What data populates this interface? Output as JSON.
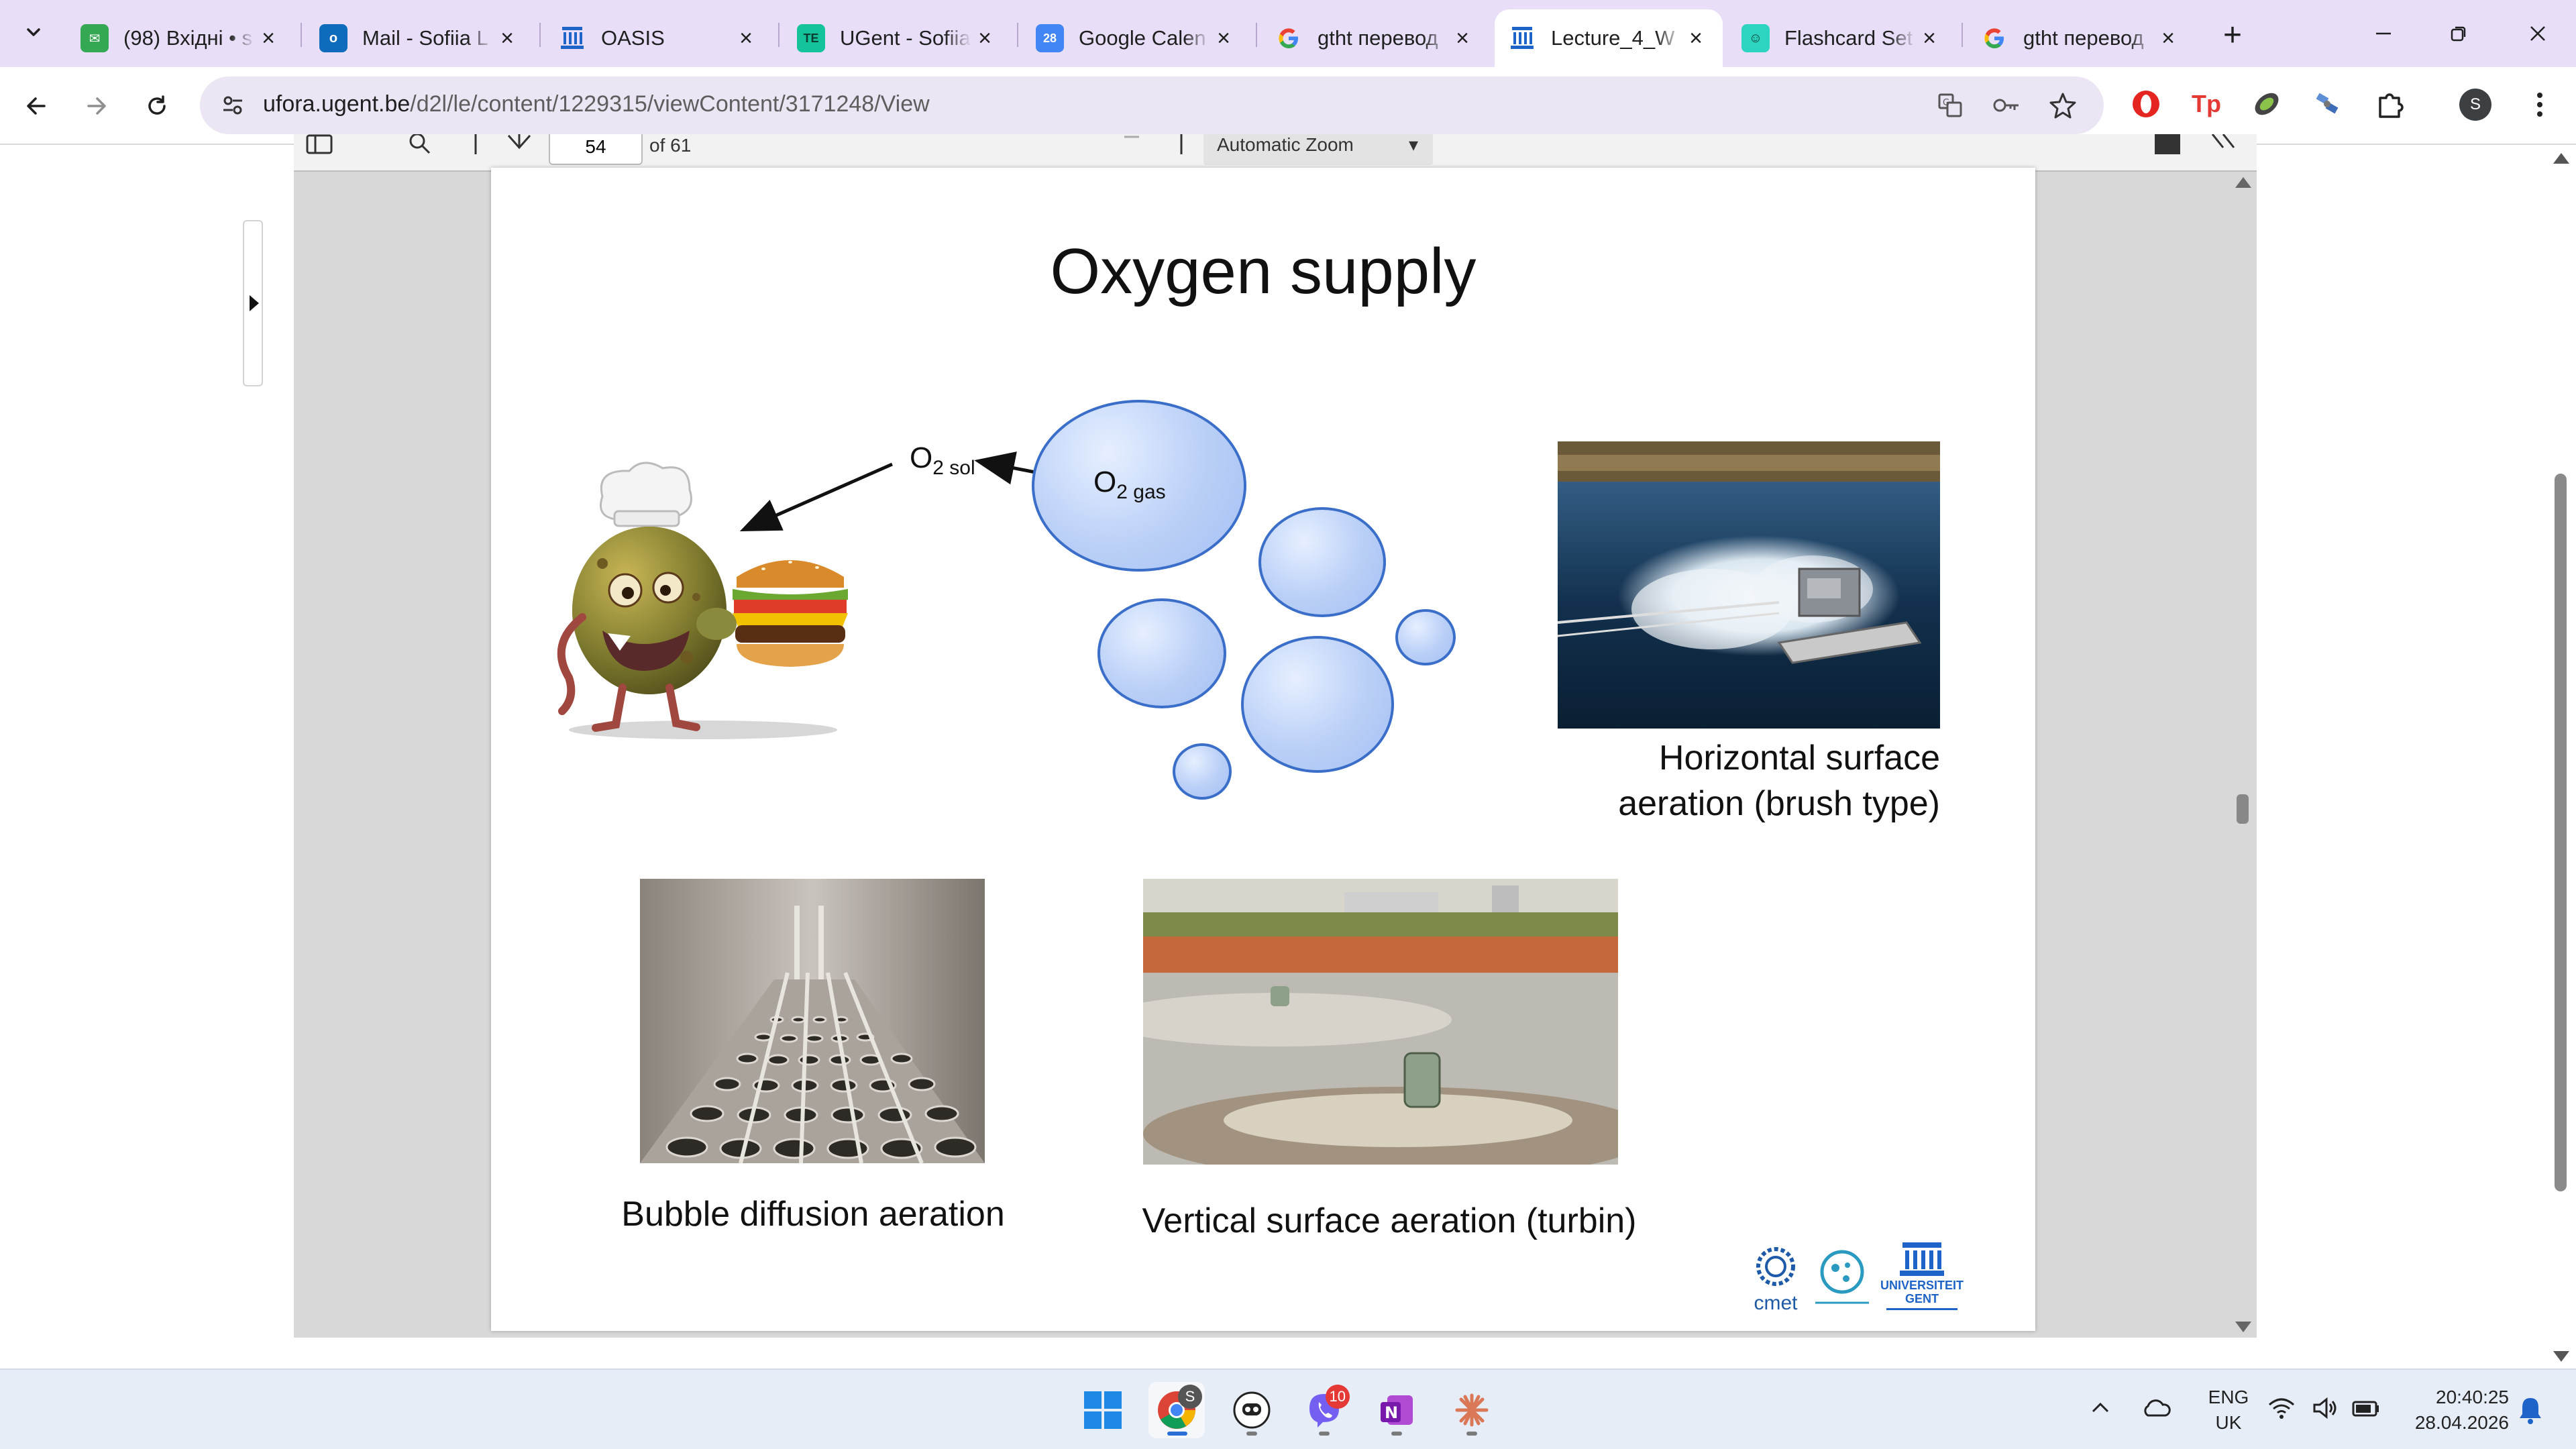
{
  "browser": {
    "tabs": [
      {
        "title": "(98) Вхідні • s",
        "favicon": "gmail-icon",
        "color": "#34a853",
        "active": false
      },
      {
        "title": "Mail - Sofiia L",
        "favicon": "outlook-icon",
        "color": "#0f6cbd",
        "active": false
      },
      {
        "title": "OASIS",
        "favicon": "ugent-icon",
        "color": "#1e64c8",
        "active": false
      },
      {
        "title": "UGent - Sofiia",
        "favicon": "te-icon",
        "color": "#15c39a",
        "active": false
      },
      {
        "title": "Google Calen",
        "favicon": "calendar-icon",
        "color": "#4285f4",
        "active": false
      },
      {
        "title": "gtht перевод",
        "favicon": "google-icon",
        "color": "#4285f4",
        "active": false
      },
      {
        "title": "Lecture_4_W",
        "favicon": "ugent-icon",
        "color": "#1e64c8",
        "active": true
      },
      {
        "title": "Flashcard Set",
        "favicon": "quizlet-icon",
        "color": "#2dd4bf",
        "active": false
      },
      {
        "title": "gtht перевод",
        "favicon": "google-icon",
        "color": "#4285f4",
        "active": false
      }
    ],
    "url_host": "ufora.ugent.be",
    "url_path": "/d2l/le/content/1229315/viewContent/3171248/View",
    "profile_initial": "S"
  },
  "pdf_toolbar": {
    "page_number": "54",
    "page_count": "of 61",
    "zoom": "Automatic Zoom"
  },
  "slide": {
    "title": "Oxygen supply",
    "o2_sol": {
      "base": "O",
      "sub": "2 sol"
    },
    "o2_gas": {
      "base": "O",
      "sub": "2 gas"
    },
    "caption_horizontal_1": "Horizontal surface",
    "caption_horizontal_2": "aeration (brush type)",
    "caption_bubble": "Bubble diffusion aeration",
    "caption_vertical": "Vertical surface aeration (turbin)",
    "logo_cmet": "cmet",
    "logo_ugent_1": "UNIVERSITEIT",
    "logo_ugent_2": "GENT"
  },
  "taskbar": {
    "chrome_badge": "S",
    "viber_badge": "10",
    "lang_1": "ENG",
    "lang_2": "UK",
    "time": "20:40:25",
    "date": "28.04.2026"
  }
}
